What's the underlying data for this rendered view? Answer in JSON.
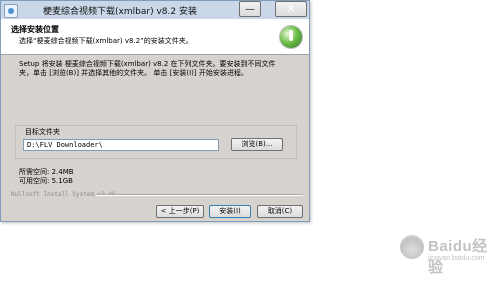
{
  "window": {
    "title": "梗麦综合视频下载(xmlbar) v8.2 安装",
    "controls": {
      "minimize": "—",
      "close": "✕"
    }
  },
  "header": {
    "heading": "选择安装位置",
    "subheading": "选择“梗麦综合视频下载(xmlbar) v8.2”的安装文件夹。"
  },
  "description": {
    "line1": "Setup 将安装 梗麦综合视频下载(xmlbar) v8.2 在下列文件夹。要安装到不同文件",
    "line2": "夹，单击 [浏览(B)] 并选择其他的文件夹。 单击 [安装(I)] 开始安装进程。"
  },
  "destination": {
    "label": "目标文件夹",
    "path": "D:\\FLV Downloader\\",
    "browse_label": "浏览(B)..."
  },
  "space": {
    "required": "所需空间: 2.4MB",
    "available": "可用空间: 5.1GB"
  },
  "branding": "Nullsoft Install System v2.46",
  "buttons": {
    "back": "< 上一步(P)",
    "install": "安装(I)",
    "cancel": "取消(C)"
  },
  "watermark": {
    "text": "Baidu经验",
    "url": "jingyan.baidu.com"
  }
}
